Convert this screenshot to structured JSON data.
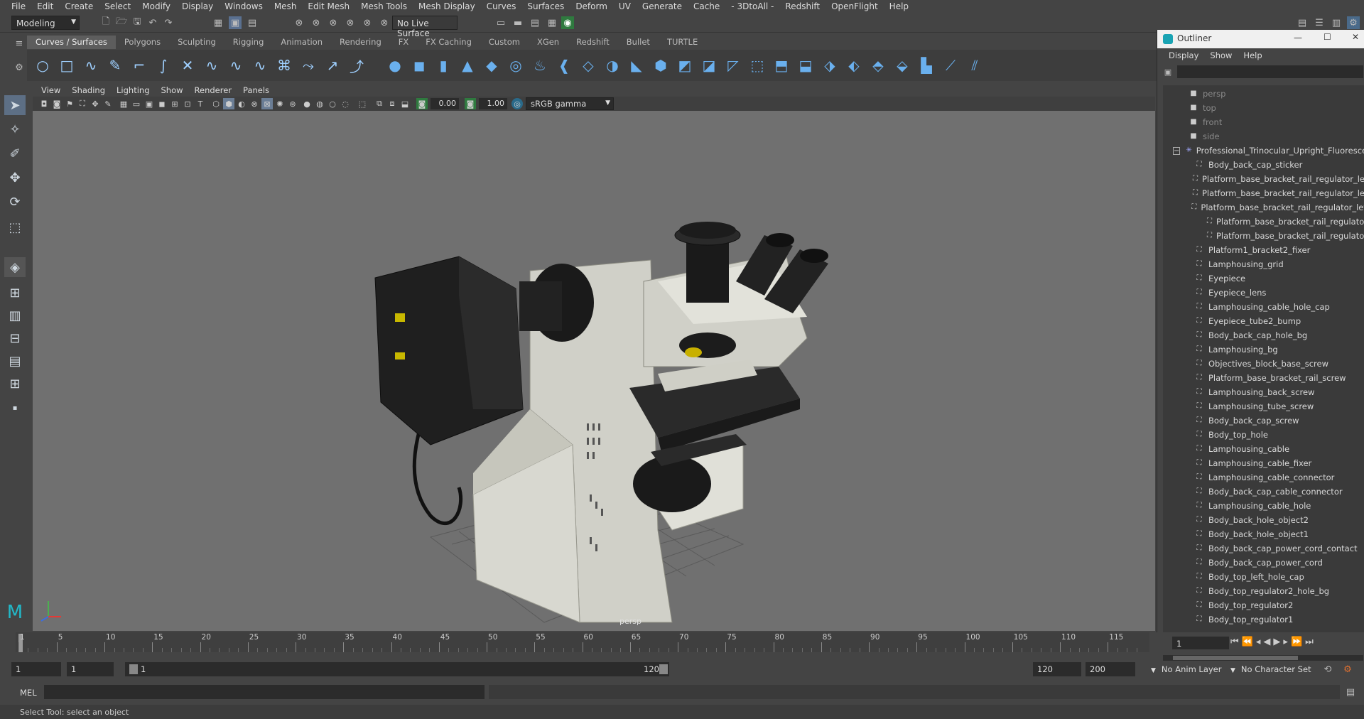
{
  "menubar": {
    "items": [
      "File",
      "Edit",
      "Create",
      "Select",
      "Modify",
      "Display",
      "Windows",
      "Mesh",
      "Edit Mesh",
      "Mesh Tools",
      "Mesh Display",
      "Curves",
      "Surfaces",
      "Deform",
      "UV",
      "Generate",
      "Cache",
      "- 3DtoAll -",
      "Redshift",
      "OpenFlight",
      "Help"
    ]
  },
  "status": {
    "mode": "Modeling",
    "live_surface": "No Live Surface"
  },
  "shelf": {
    "tabs": [
      "Curves / Surfaces",
      "Polygons",
      "Sculpting",
      "Rigging",
      "Animation",
      "Rendering",
      "FX",
      "FX Caching",
      "Custom",
      "XGen",
      "Redshift",
      "Bullet",
      "TURTLE"
    ],
    "active": "Curves / Surfaces"
  },
  "viewport": {
    "menu": [
      "View",
      "Shading",
      "Lighting",
      "Show",
      "Renderer",
      "Panels"
    ],
    "near_value": "0.00",
    "far_value": "1.00",
    "color_space": "sRGB gamma",
    "camera_label": "persp",
    "colors": {
      "background": "#707070",
      "model_body": "#d4d4cc",
      "model_dark": "#1e1e1e"
    }
  },
  "outliner": {
    "title": "Outliner",
    "menu": [
      "Display",
      "Show",
      "Help"
    ],
    "cameras": [
      "persp",
      "top",
      "front",
      "side"
    ],
    "root": "Professional_Trinocular_Upright_Fluorescence_Microscope",
    "items": [
      {
        "label": "Body_back_cap_sticker",
        "level": 1
      },
      {
        "label": "Platform_base_bracket_rail_regulator_left",
        "level": 1
      },
      {
        "label": "Platform_base_bracket_rail_regulator_left",
        "level": 1
      },
      {
        "label": "Platform_base_bracket_rail_regulator_left",
        "level": 1,
        "expanded": true
      },
      {
        "label": "Platform_base_bracket_rail_regulator",
        "level": 2
      },
      {
        "label": "Platform_base_bracket_rail_regulator",
        "level": 2
      },
      {
        "label": "Platform1_bracket2_fixer",
        "level": 1
      },
      {
        "label": "Lamphousing_grid",
        "level": 1
      },
      {
        "label": "Eyepiece",
        "level": 1
      },
      {
        "label": "Eyepiece_lens",
        "level": 1
      },
      {
        "label": "Lamphousing_cable_hole_cap",
        "level": 1
      },
      {
        "label": "Eyepiece_tube2_bump",
        "level": 1
      },
      {
        "label": "Body_back_cap_hole_bg",
        "level": 1
      },
      {
        "label": "Lamphousing_bg",
        "level": 1
      },
      {
        "label": "Objectives_block_base_screw",
        "level": 1
      },
      {
        "label": "Platform_base_bracket_rail_screw",
        "level": 1
      },
      {
        "label": "Lamphousing_back_screw",
        "level": 1
      },
      {
        "label": "Lamphousing_tube_screw",
        "level": 1
      },
      {
        "label": "Body_back_cap_screw",
        "level": 1
      },
      {
        "label": "Body_top_hole",
        "level": 1
      },
      {
        "label": "Lamphousing_cable",
        "level": 1
      },
      {
        "label": "Lamphousing_cable_fixer",
        "level": 1
      },
      {
        "label": "Lamphousing_cable_connector",
        "level": 1
      },
      {
        "label": "Body_back_cap_cable_connector",
        "level": 1
      },
      {
        "label": "Lamphousing_cable_hole",
        "level": 1
      },
      {
        "label": "Body_back_hole_object2",
        "level": 1
      },
      {
        "label": "Body_back_hole_object1",
        "level": 1
      },
      {
        "label": "Body_back_cap_power_cord_contact",
        "level": 1
      },
      {
        "label": "Body_back_cap_power_cord",
        "level": 1
      },
      {
        "label": "Body_top_left_hole_cap",
        "level": 1
      },
      {
        "label": "Body_top_regulator2_hole_bg",
        "level": 1
      },
      {
        "label": "Body_top_regulator2",
        "level": 1
      },
      {
        "label": "Body_top_regulator1",
        "level": 1
      }
    ]
  },
  "timeline": {
    "ticks": [
      "1",
      "5",
      "10",
      "15",
      "20",
      "25",
      "30",
      "35",
      "40",
      "45",
      "50",
      "55",
      "60",
      "65",
      "70",
      "75",
      "80",
      "85",
      "90",
      "95",
      "100",
      "105",
      "110",
      "115"
    ],
    "current_frame": "1"
  },
  "range": {
    "start": "1",
    "playback_start": "1",
    "range_start": "1",
    "range_end": "120",
    "end": "120",
    "playback_end": "200",
    "anim_layer": "No Anim Layer",
    "character_set": "No Character Set"
  },
  "cmdline": {
    "label": "MEL"
  },
  "help": {
    "text": "Select Tool: select an object"
  }
}
